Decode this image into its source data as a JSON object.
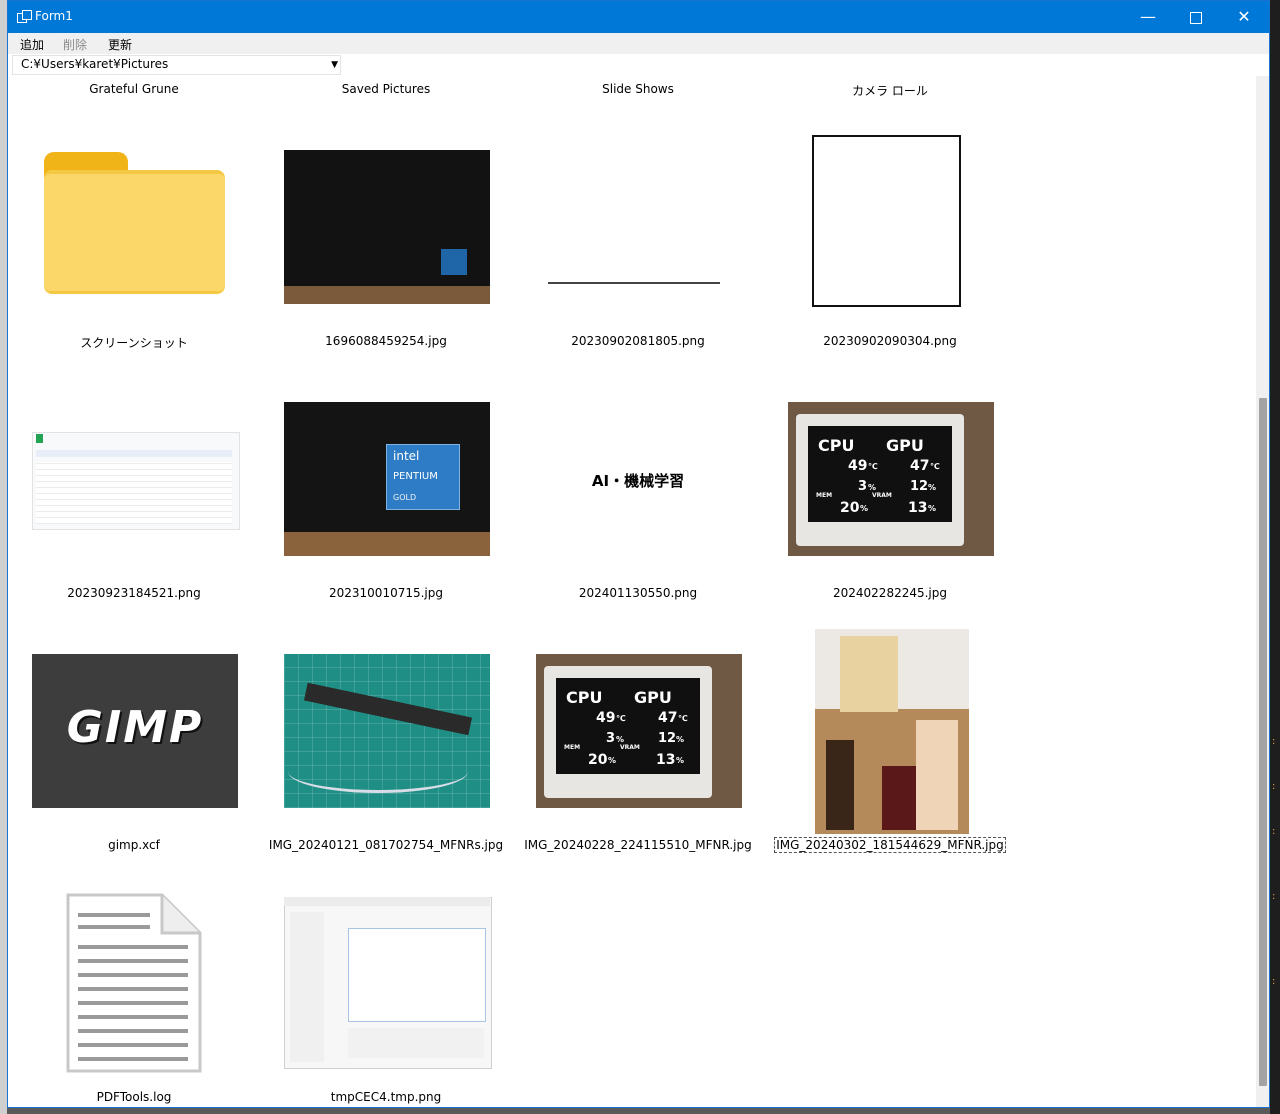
{
  "window": {
    "title": "Form1"
  },
  "menu": {
    "add": "追加",
    "delete": "削除",
    "refresh": "更新"
  },
  "path": {
    "value": "C:¥Users¥karet¥Pictures"
  },
  "top_row": [
    "Grateful Grune",
    "Saved Pictures",
    "Slide Shows",
    "カメラ ロール"
  ],
  "items": [
    {
      "name": "スクリーンショット"
    },
    {
      "name": "1696088459254.jpg"
    },
    {
      "name": "20230902081805.png"
    },
    {
      "name": "20230902090304.png"
    },
    {
      "name": "20230923184521.png"
    },
    {
      "name": "202310010715.jpg"
    },
    {
      "name": "202401130550.png",
      "thumb_text": "AI・機械学習"
    },
    {
      "name": "202402282245.jpg"
    },
    {
      "name": "gimp.xcf",
      "thumb_text": "GIMP"
    },
    {
      "name": "IMG_20240121_081702754_MFNRs.jpg"
    },
    {
      "name": "IMG_20240228_224115510_MFNR.jpg"
    },
    {
      "name": "IMG_20240302_181544629_MFNR.jpg"
    },
    {
      "name": "PDFTools.log"
    },
    {
      "name": "tmpCEC4.tmp.png"
    }
  ],
  "badges": {
    "intel": "intel",
    "pentium": "PENTIUM",
    "gold": "GOLD"
  },
  "monitor": {
    "cpu": "CPU",
    "gpu": "GPU",
    "cpu_temp": "49",
    "gpu_temp": "47",
    "temp_unit": "℃",
    "mem_label": "MEM",
    "vram_label": "VRAM",
    "cpu_load": "3",
    "gpu_load": "12",
    "mem_use": "20",
    "vram_use": "13",
    "pct": "%"
  },
  "colors": {
    "title_bar": "#0078d7",
    "folder": "#f5c843",
    "gimp_bg": "#3d3d3d"
  },
  "icons": {
    "app": "window-icon",
    "folder": "folder-icon",
    "document": "document-icon"
  }
}
